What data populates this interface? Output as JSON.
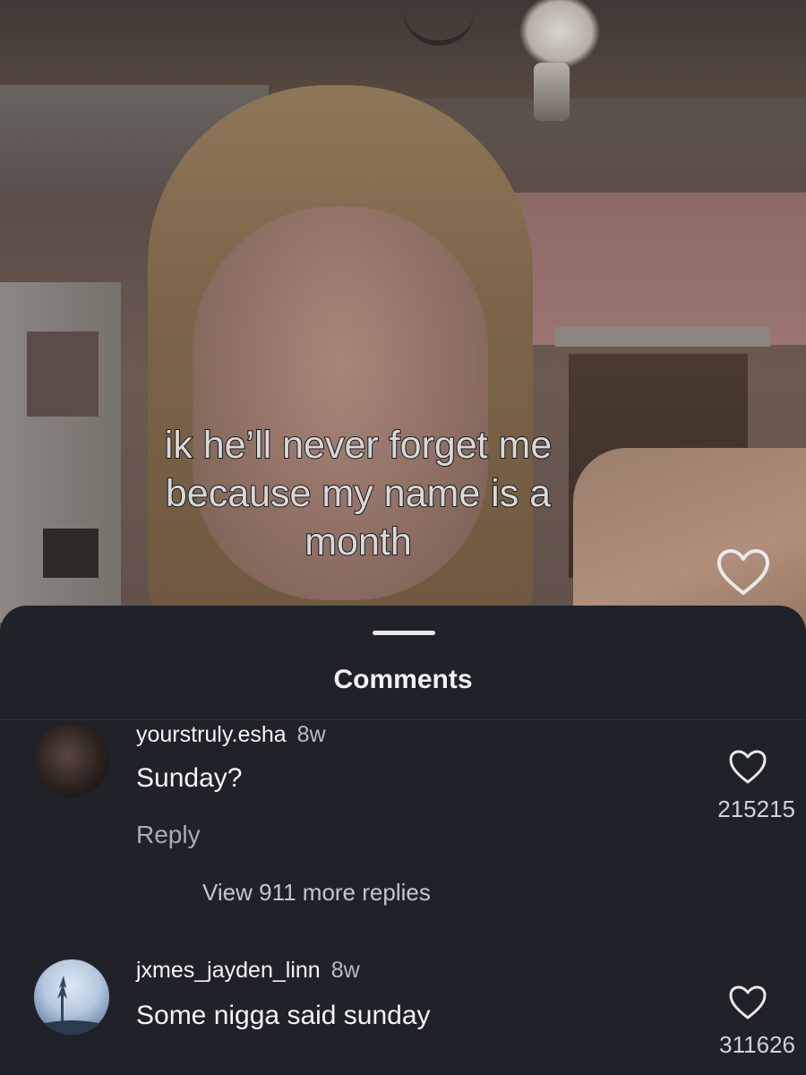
{
  "video": {
    "caption": "ik he’ll never forget me\nbecause my name is a\nmonth"
  },
  "sheet": {
    "title": "Comments",
    "view_more_replies": "View 911 more replies"
  },
  "comments": [
    {
      "username": "yourstruly.esha",
      "time": "8w",
      "text": "Sunday?",
      "reply_label": "Reply",
      "likes": "215215"
    },
    {
      "username": "jxmes_jayden_linn",
      "time": "8w",
      "text": "Some nigga said sunday",
      "likes": "311626"
    }
  ],
  "colors": {
    "sheet_background": "#1f2228",
    "primary_text": "#f4f4f4",
    "secondary_text": "#a9adb5"
  },
  "icons": [
    "heart-icon",
    "grabber-handle"
  ]
}
